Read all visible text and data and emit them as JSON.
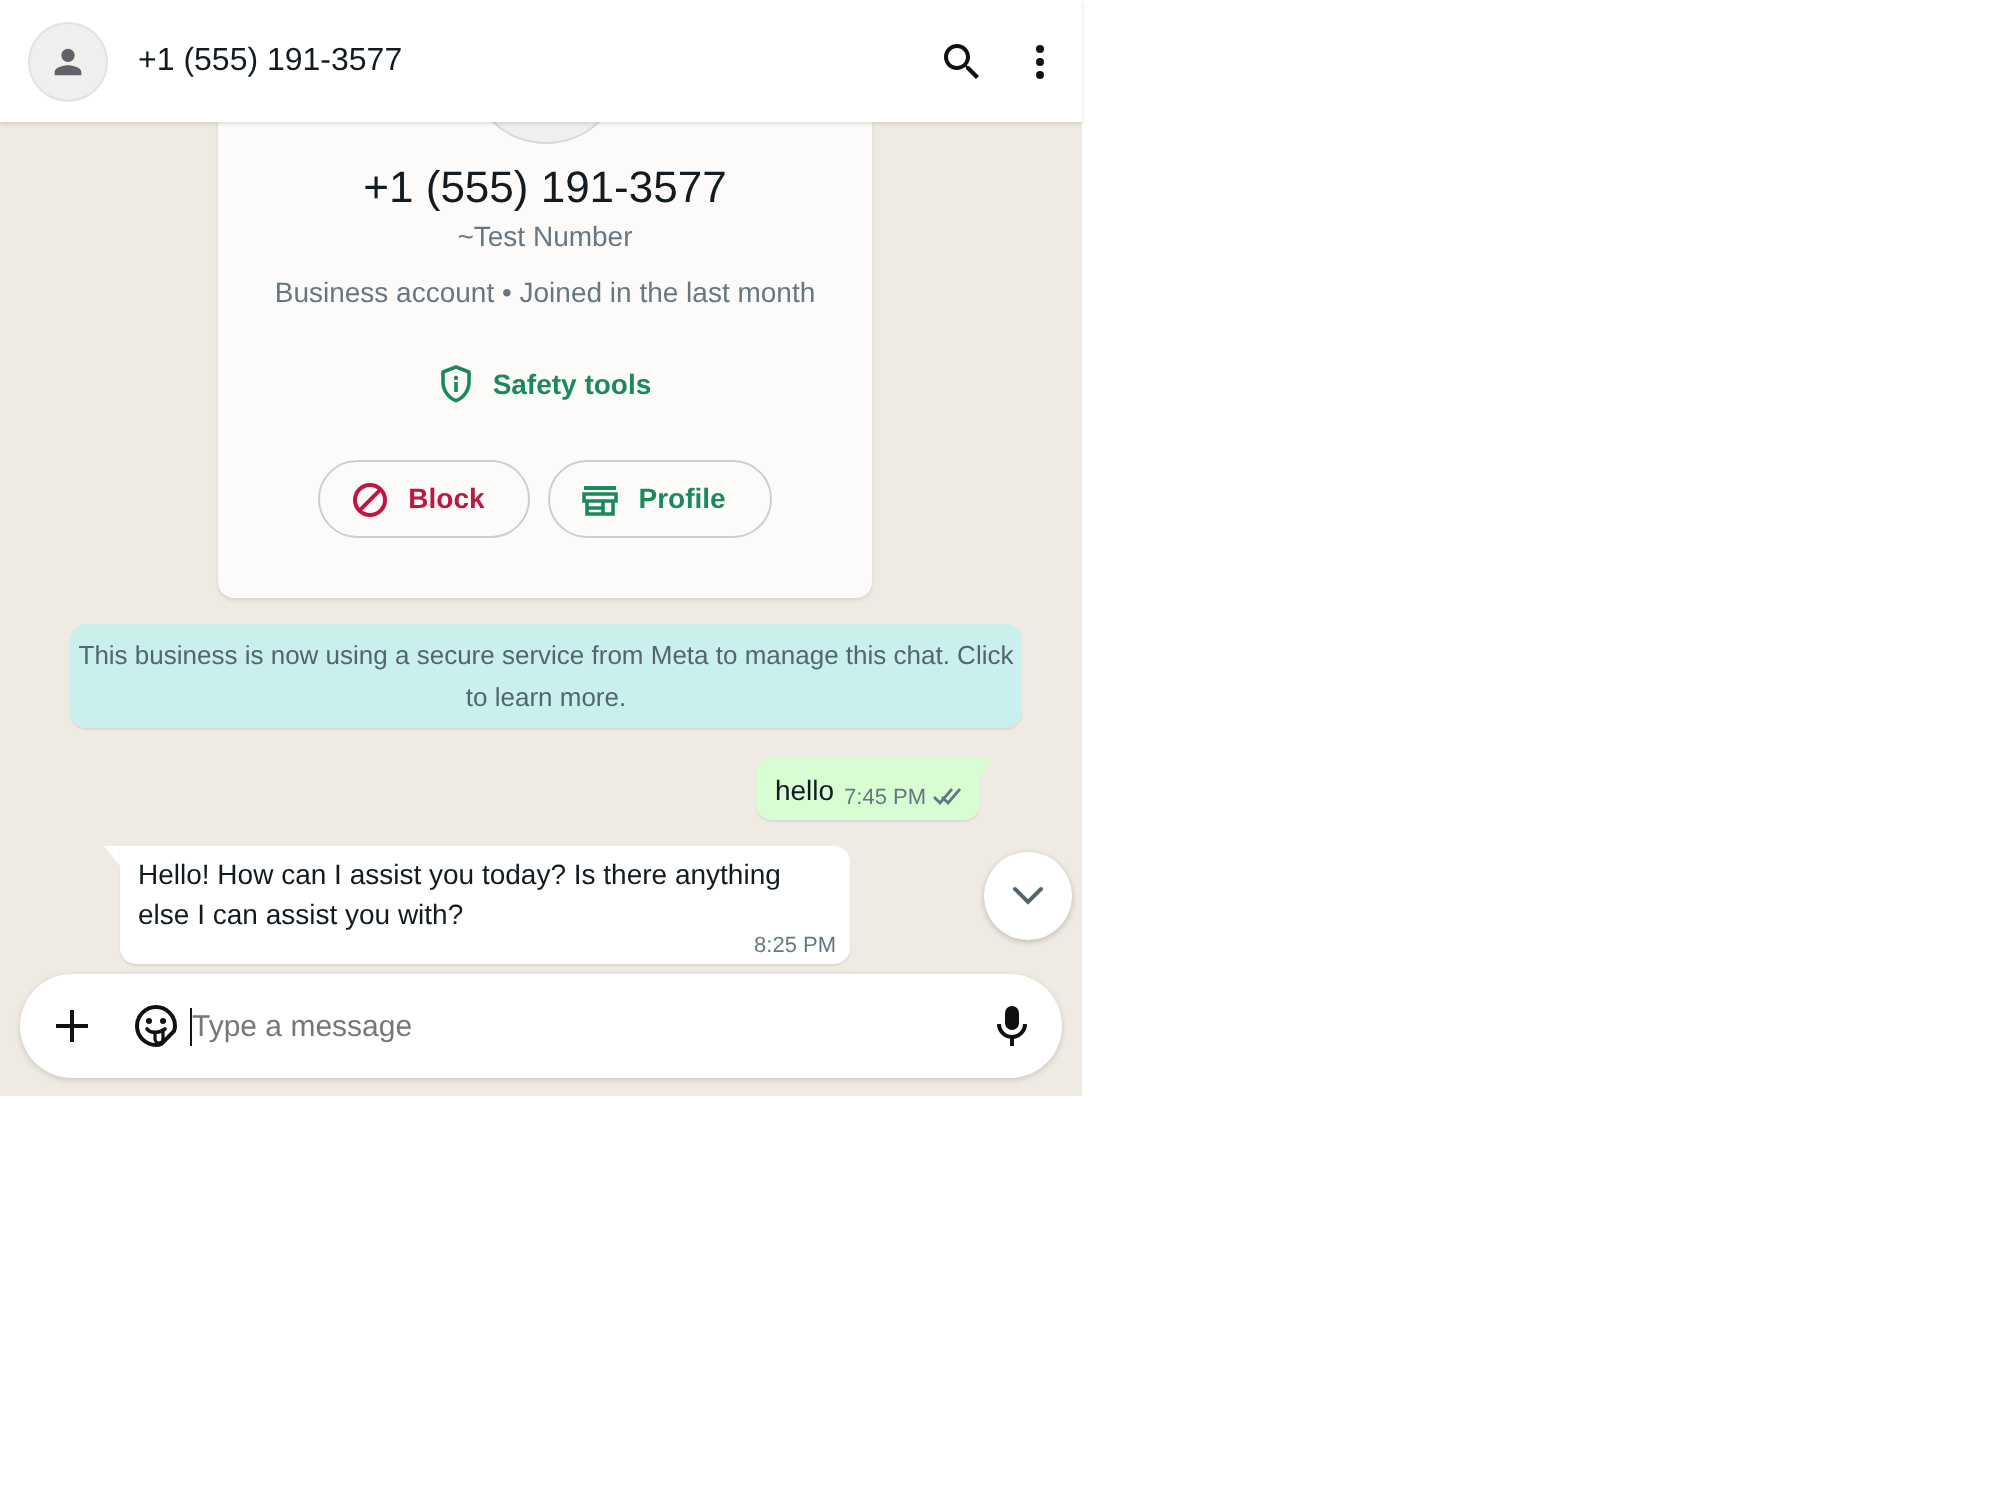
{
  "header": {
    "title": "+1 (555) 191-3577"
  },
  "contact_card": {
    "phone": "+1 (555) 191-3577",
    "name": "~Test Number",
    "details": "Business account • Joined in the last month",
    "safety_link": "Safety tools",
    "buttons": [
      {
        "label": "Block",
        "kind": "block"
      },
      {
        "label": "Profile",
        "kind": "profile"
      }
    ]
  },
  "notice": "This business is now using a secure service from Meta to manage this chat. Click to learn more.",
  "messages": [
    {
      "kind": "outgoing",
      "text": "hello",
      "time": "7:45 PM",
      "read": false
    },
    {
      "kind": "incoming",
      "text": "Hello! How can I assist you today? Is there anything else I can assist you with?",
      "time": "8:25 PM"
    }
  ],
  "composer": {
    "placeholder": "Type a message"
  }
}
